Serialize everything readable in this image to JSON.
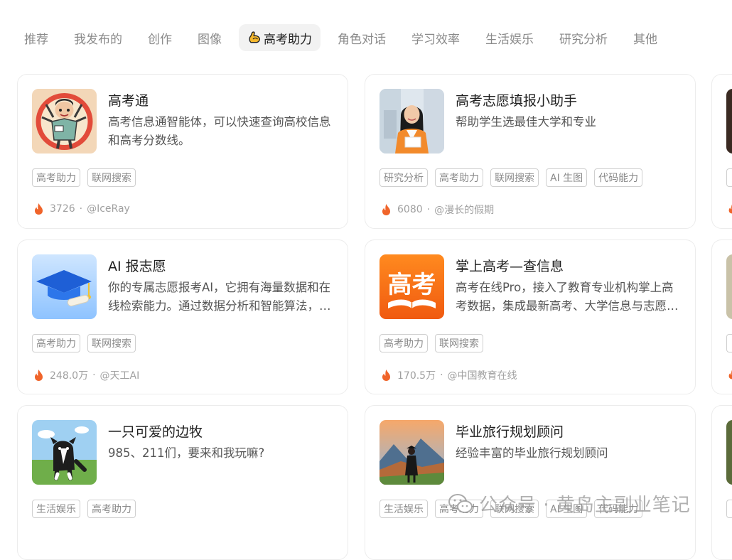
{
  "tabs": [
    {
      "label": "推荐",
      "active": false
    },
    {
      "label": "我发布的",
      "active": false
    },
    {
      "label": "创作",
      "active": false
    },
    {
      "label": "图像",
      "active": false
    },
    {
      "label": "高考助力",
      "active": true,
      "icon": "flexed-arm-icon"
    },
    {
      "label": "角色对话",
      "active": false
    },
    {
      "label": "学习效率",
      "active": false
    },
    {
      "label": "生活娱乐",
      "active": false
    },
    {
      "label": "研究分析",
      "active": false
    },
    {
      "label": "其他",
      "active": false
    }
  ],
  "cards": [
    {
      "title": "高考通",
      "desc": "高考信息通智能体，可以快速查询高校信息和高考分数线。",
      "tags": [
        "高考助力",
        "联网搜索"
      ],
      "heat": "3726",
      "author": "@IceRay",
      "avatar": "cartoon-student-avatar"
    },
    {
      "title": "高考志愿填报小助手",
      "desc": "帮助学生选最佳大学和专业",
      "tags": [
        "研究分析",
        "高考助力",
        "联网搜索",
        "AI 生图",
        "代码能力"
      ],
      "heat": "6080",
      "author": "@漫长的假期",
      "avatar": "student-girl-photo-avatar"
    },
    {
      "title": "AI 报志愿",
      "desc": "你的专属志愿报考AI，它拥有海量数据和在线检索能力。通过数据分析和智能算法，为你推荐最合适的院校和专业。",
      "tags": [
        "高考助力",
        "联网搜索"
      ],
      "heat": "248.0万",
      "author": "@天工AI",
      "avatar": "graduation-cap-avatar"
    },
    {
      "title": "掌上高考—查信息",
      "desc": "高考在线Pro，接入了教育专业机构掌上高考数据，集成最新高考、大学信息与志愿填报参考。",
      "tags": [
        "高考助力",
        "联网搜索"
      ],
      "heat": "170.5万",
      "author": "@中国教育在线",
      "avatar": "gaokao-book-logo-avatar",
      "avatar_text": "高考"
    },
    {
      "title": "一只可爱的边牧",
      "desc": "985、211们，要来和我玩嘛?",
      "tags": [
        "生活娱乐",
        "高考助力"
      ],
      "heat": "",
      "author": "",
      "avatar": "border-collie-dog-avatar"
    },
    {
      "title": "毕业旅行规划顾问",
      "desc": "经验丰富的毕业旅行规划顾问",
      "tags": [
        "生活娱乐",
        "高考助力",
        "联网搜索",
        "AI 生图",
        "代码能力"
      ],
      "heat": "",
      "author": "",
      "avatar": "traveler-landscape-avatar"
    }
  ],
  "watermark": {
    "text": "公众号 · 黄岛主副业笔记",
    "icon": "wechat-icon"
  },
  "colors": {
    "accent_fire": "#f0642a",
    "tab_active_bg": "#f2f2f2",
    "muted_text": "#8a8a8a"
  }
}
